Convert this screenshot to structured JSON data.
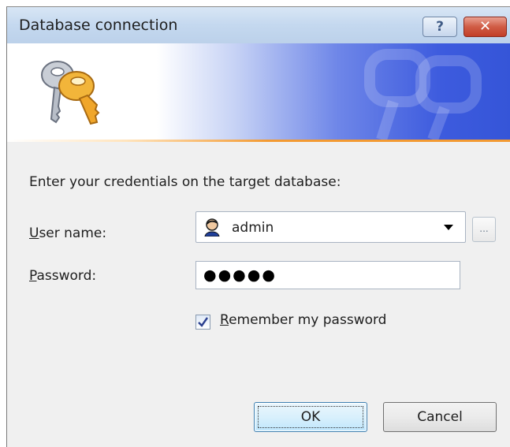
{
  "window": {
    "title": "Database connection",
    "help_label": "?",
    "close_label": "✕"
  },
  "banner": {
    "icon": "keys-icon",
    "accent_color": "#3555d8",
    "line_color": "#f39a32"
  },
  "form": {
    "instruction": "Enter your credentials on the target database:",
    "username_label_accel": "U",
    "username_label_rest": "ser name:",
    "username_value": "admin",
    "username_icon": "user-icon",
    "browse_label": "...",
    "password_label_accel": "P",
    "password_label_rest": "assword:",
    "password_masked": "●●●●●",
    "remember_checked": true,
    "remember_label_accel": "R",
    "remember_label_rest": "emember my password"
  },
  "buttons": {
    "ok": "OK",
    "cancel": "Cancel"
  }
}
